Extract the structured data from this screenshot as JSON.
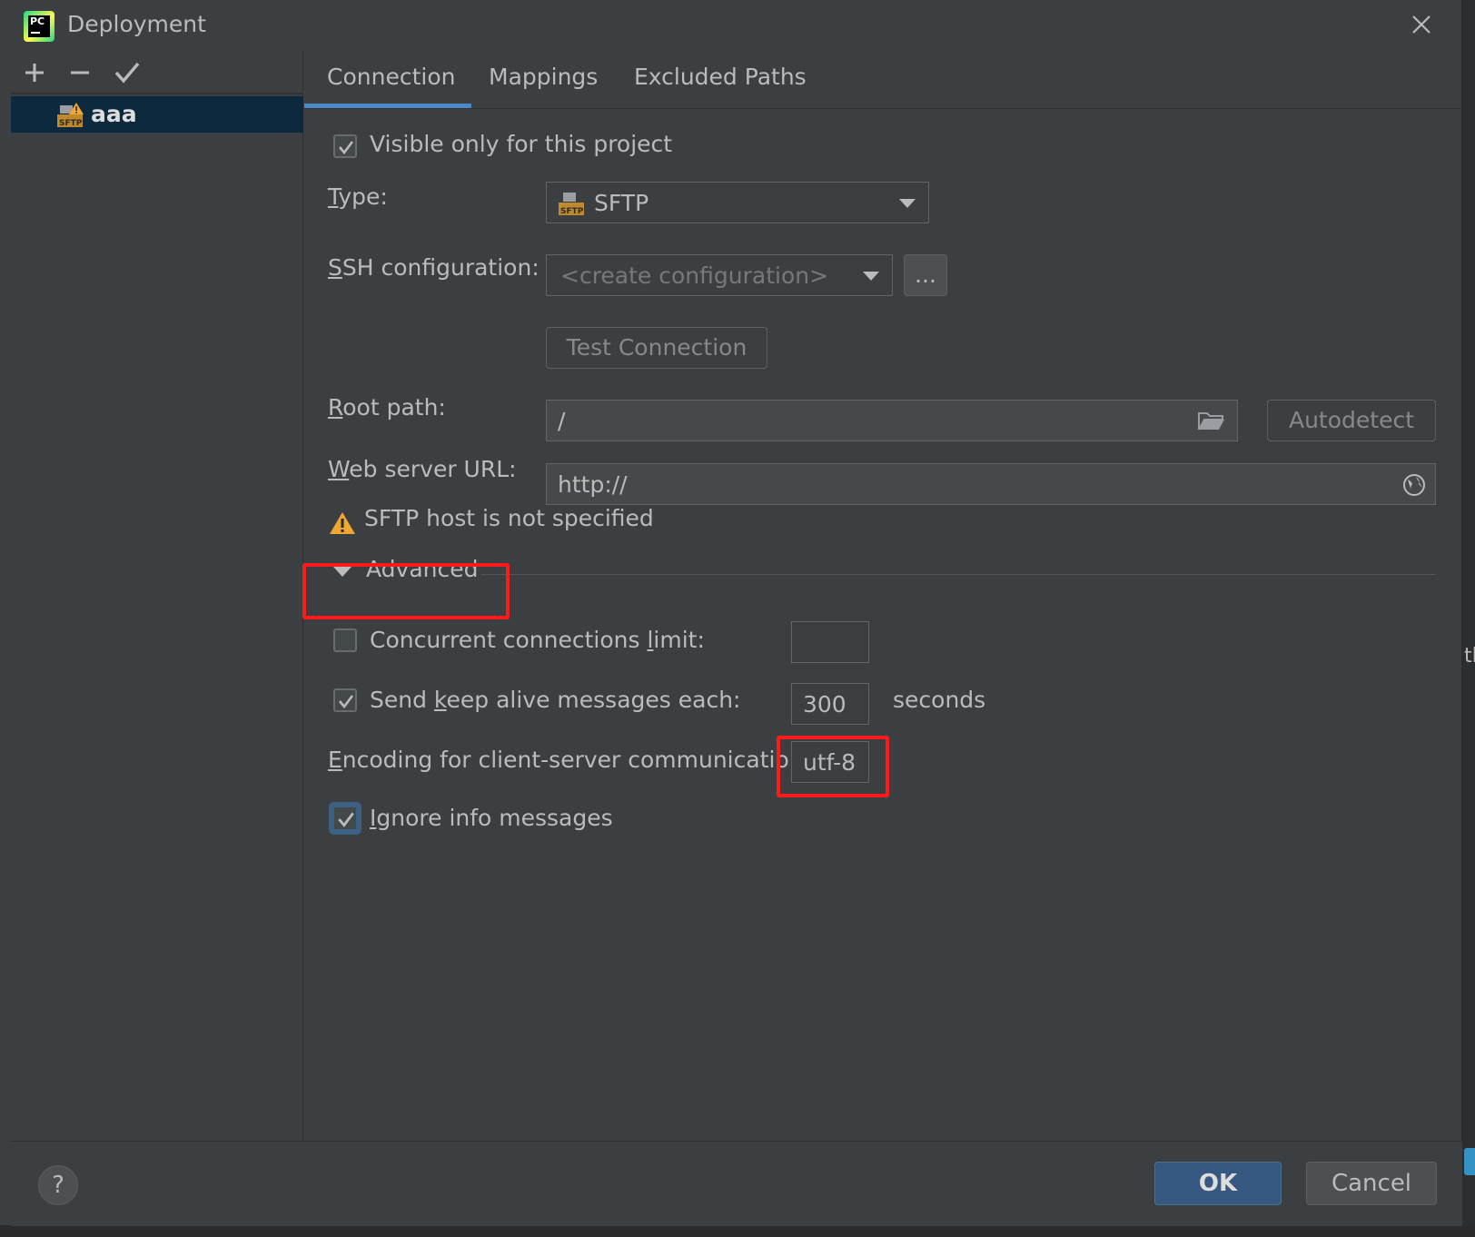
{
  "window": {
    "title": "Deployment",
    "app_icon": "pycharm-logo-icon",
    "close_icon": "close-icon"
  },
  "sidebar": {
    "toolbar": {
      "add_icon": "plus-icon",
      "remove_icon": "minus-icon",
      "default_icon": "checkmark-icon"
    },
    "items": [
      {
        "label": "aaa",
        "icon": "sftp-warning-icon",
        "selected": true
      }
    ]
  },
  "tabs": [
    {
      "label": "Connection",
      "active": true
    },
    {
      "label": "Mappings",
      "active": false
    },
    {
      "label": "Excluded Paths",
      "active": false
    }
  ],
  "connection": {
    "visible_only": {
      "label": "Visible only for this project",
      "checked": true
    },
    "type": {
      "label_mnemonic": "T",
      "label_rest": "ype:",
      "value": "SFTP",
      "icon": "sftp-icon"
    },
    "ssh": {
      "label_mnemonic": "S",
      "label_rest": "SH configuration:",
      "placeholder": "<create configuration>",
      "browse_label": "..."
    },
    "test_button": "Test Connection",
    "root_path": {
      "label_mnemonic": "R",
      "label_rest": "oot path:",
      "value": "/",
      "folder_icon": "folder-icon",
      "autodetect_label": "Autodetect"
    },
    "web_url": {
      "label_mnemonic": "W",
      "label_rest": "eb server URL:",
      "value": "http://",
      "globe_icon": "globe-icon"
    },
    "warning": {
      "icon": "warning-icon",
      "text": "SFTP host is not specified"
    }
  },
  "advanced": {
    "header": "Advanced",
    "expanded": true,
    "concurrent": {
      "label_pre": "Concurrent connections ",
      "label_mnemonic": "l",
      "label_post": "imit:",
      "checked": false,
      "value": ""
    },
    "keep_alive": {
      "label_pre": "Send ",
      "label_mnemonic": "k",
      "label_post": "eep alive messages each:",
      "checked": true,
      "value": "300",
      "unit": "seconds"
    },
    "encoding": {
      "label_mnemonic": "E",
      "label_rest": "ncoding for client-server communication:",
      "value": "utf-8"
    },
    "ignore_info": {
      "label_mnemonic": "I",
      "label_rest": "gnore info messages",
      "checked": true
    }
  },
  "footer": {
    "help_label": "?",
    "ok_label": "OK",
    "cancel_label": "Cancel"
  },
  "background": {
    "side_text": "tl"
  },
  "colors": {
    "accent": "#4a88c7",
    "highlight": "#ff1a1a",
    "selection": "#0d293e",
    "ok_button": "#365880",
    "warning": "#f0a732"
  }
}
